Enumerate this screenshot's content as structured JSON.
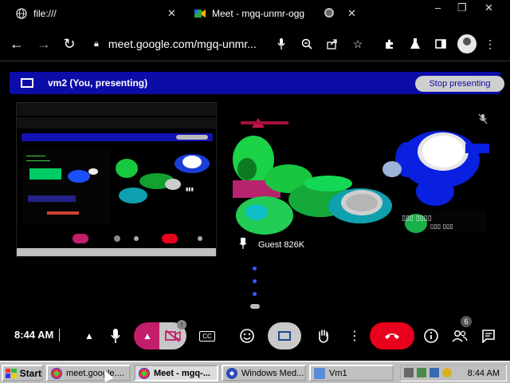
{
  "browser": {
    "tabs": [
      {
        "title": "file:///",
        "icon": "globe-icon"
      },
      {
        "title": "Meet - mgq-unmr-ogg",
        "icon": "meet-icon"
      }
    ],
    "address": "meet.google.com/mgq-unmr..."
  },
  "banner": {
    "title": "vm2 (You, presenting)",
    "stop_label": "Stop presenting",
    "color": "#0c0ca8"
  },
  "participant": {
    "name": "Guest 826K"
  },
  "controls": {
    "time": "8:44 AM",
    "camera_badge": "!",
    "people_count": "6",
    "end_call_color": "#e8001c",
    "camera_color": "#c21e6a"
  },
  "taskbar": {
    "start_label": "Start",
    "items": [
      {
        "label": "meet.google....",
        "active": false
      },
      {
        "label": "Meet - mgq-...",
        "active": true
      },
      {
        "label": "Windows Med...",
        "active": false
      },
      {
        "label": "Vm1",
        "active": false
      }
    ],
    "clock": "8:44 AM"
  }
}
